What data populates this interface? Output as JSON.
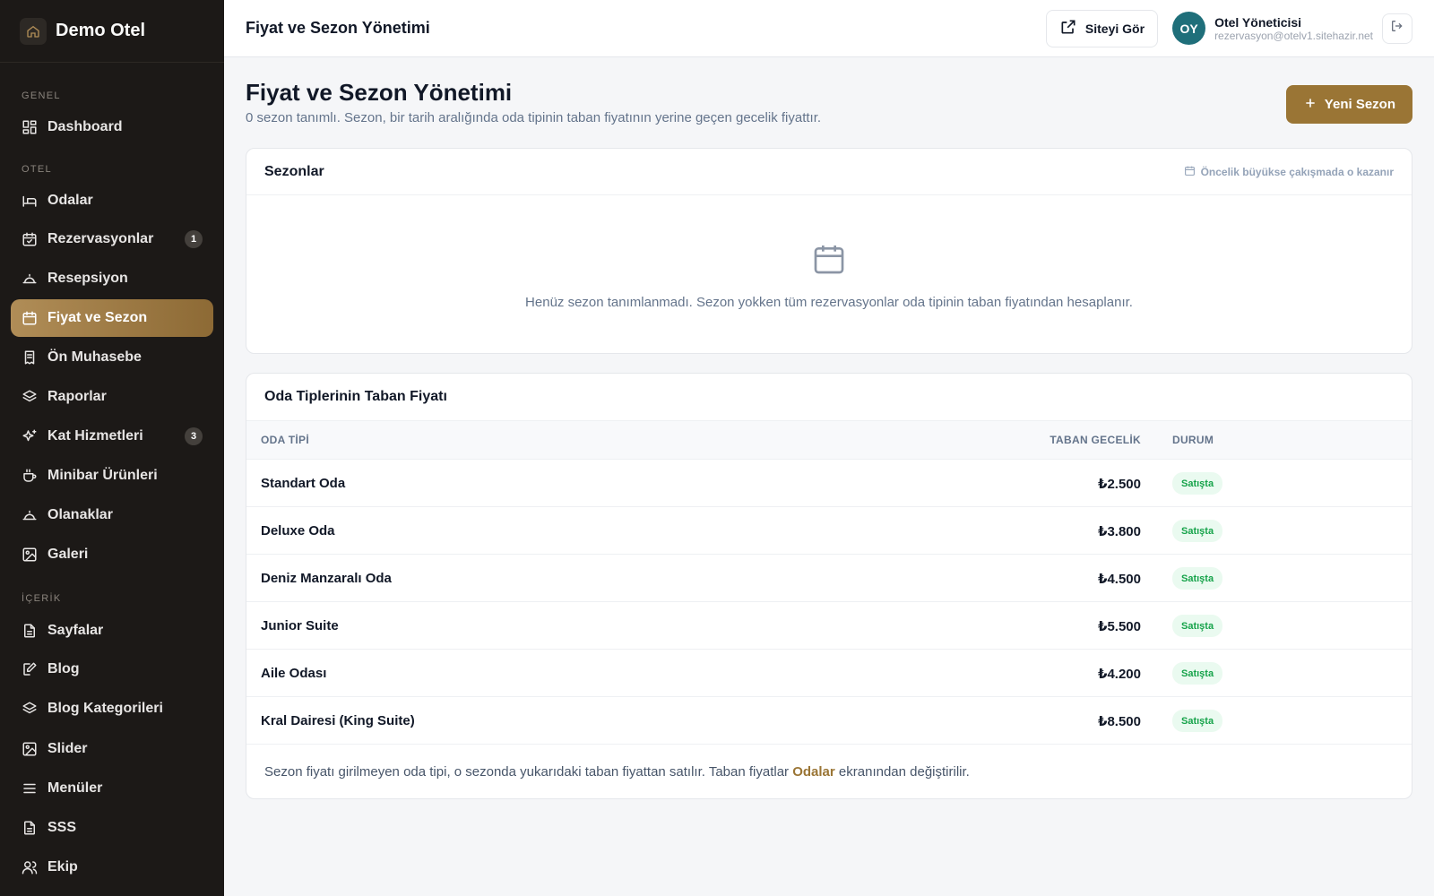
{
  "brand": {
    "name": "Demo Otel"
  },
  "sidebar": {
    "sections": {
      "genel": "GENEL",
      "otel": "OTEL",
      "icerik": "İÇERİK"
    },
    "items": [
      {
        "label": "Dashboard",
        "icon": "dashboard-icon"
      },
      {
        "label": "Odalar",
        "icon": "bed-icon"
      },
      {
        "label": "Rezervasyonlar",
        "icon": "calendar-check-icon",
        "badge": "1"
      },
      {
        "label": "Resepsiyon",
        "icon": "bell-icon"
      },
      {
        "label": "Fiyat ve Sezon",
        "icon": "calendar-icon",
        "active": true
      },
      {
        "label": "Ön Muhasebe",
        "icon": "receipt-icon"
      },
      {
        "label": "Raporlar",
        "icon": "layers-icon"
      },
      {
        "label": "Kat Hizmetleri",
        "icon": "sparkles-icon",
        "badge": "3"
      },
      {
        "label": "Minibar Ürünleri",
        "icon": "coffee-icon"
      },
      {
        "label": "Olanaklar",
        "icon": "bell-icon"
      },
      {
        "label": "Galeri",
        "icon": "image-icon"
      },
      {
        "label": "Sayfalar",
        "icon": "file-icon"
      },
      {
        "label": "Blog",
        "icon": "edit-icon"
      },
      {
        "label": "Blog Kategorileri",
        "icon": "layers-icon"
      },
      {
        "label": "Slider",
        "icon": "image-icon"
      },
      {
        "label": "Menüler",
        "icon": "menu-icon"
      },
      {
        "label": "SSS",
        "icon": "file-icon"
      },
      {
        "label": "Ekip",
        "icon": "users-icon"
      }
    ]
  },
  "topbar": {
    "title": "Fiyat ve Sezon Yönetimi",
    "view_site_label": "Siteyi Gör",
    "user": {
      "initials": "OY",
      "name": "Otel Yöneticisi",
      "email": "rezervasyon@otelv1.sitehazir.net"
    }
  },
  "page": {
    "title": "Fiyat ve Sezon Yönetimi",
    "subtitle": "0 sezon tanımlı. Sezon, bir tarih aralığında oda tipinin taban fiyatının yerine geçen gecelik fiyattır.",
    "new_season_label": "Yeni Sezon"
  },
  "seasons": {
    "title": "Sezonlar",
    "hint": "Öncelik büyükse çakışmada o kazanır",
    "empty_text": "Henüz sezon tanımlanmadı. Sezon yokken tüm rezervasyonlar oda tipinin taban fiyatından hesaplanır."
  },
  "prices": {
    "title": "Oda Tiplerinin Taban Fiyatı",
    "columns": {
      "room_type": "ODA TİPİ",
      "base_price": "TABAN GECELİK",
      "status": "DURUM"
    },
    "rows": [
      {
        "name": "Standart Oda",
        "price": "₺2.500",
        "status": "Satışta"
      },
      {
        "name": "Deluxe Oda",
        "price": "₺3.800",
        "status": "Satışta"
      },
      {
        "name": "Deniz Manzaralı Oda",
        "price": "₺4.500",
        "status": "Satışta"
      },
      {
        "name": "Junior Suite",
        "price": "₺5.500",
        "status": "Satışta"
      },
      {
        "name": "Aile Odası",
        "price": "₺4.200",
        "status": "Satışta"
      },
      {
        "name": "Kral Dairesi (King Suite)",
        "price": "₺8.500",
        "status": "Satışta"
      }
    ],
    "footnote_before": "Sezon fiyatı girilmeyen oda tipi, o sezonda yukarıdaki taban fiyattan satılır. Taban fiyatlar ",
    "footnote_link": "Odalar",
    "footnote_after": " ekranından değiştirilir."
  },
  "colors": {
    "sidebar_bg": "#1c1917",
    "accent": "#9a7535",
    "avatar": "#1f6f7a",
    "status": "#16a34a"
  }
}
